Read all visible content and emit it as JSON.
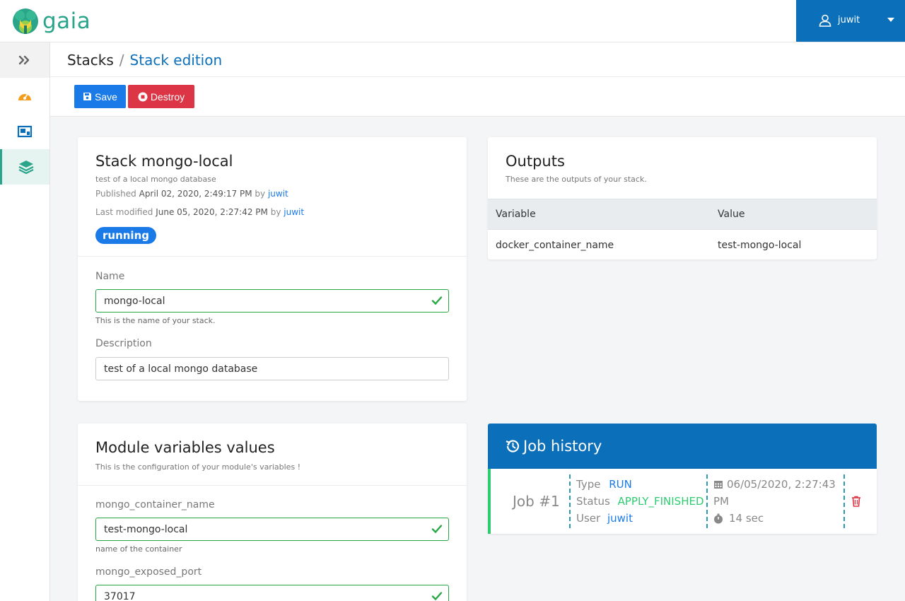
{
  "app": {
    "logo_text": "gaia"
  },
  "user": {
    "name": "juwit"
  },
  "breadcrumb": {
    "root": "Stacks",
    "separator": "/",
    "current": "Stack edition"
  },
  "toolbar": {
    "save_label": "Save",
    "destroy_label": "Destroy"
  },
  "sidebar": {
    "items": [
      {
        "icon": "dashboard-icon"
      },
      {
        "icon": "modules-icon"
      },
      {
        "icon": "stacks-icon",
        "active": true
      }
    ]
  },
  "stack_card": {
    "title": "Stack mongo-local",
    "description": "test of a local mongo database",
    "published_prefix": "Published",
    "published_date": "April 02, 2020, 2:49:17 PM",
    "published_by": "by",
    "published_user": "juwit",
    "modified_prefix": "Last modified",
    "modified_date": "June 05, 2020, 2:27:42 PM",
    "modified_by": "by",
    "modified_user": "juwit",
    "status": "running",
    "name_label": "Name",
    "name_value": "mongo-local",
    "name_help": "This is the name of your stack.",
    "description_label": "Description",
    "description_value": "test of a local mongo database"
  },
  "outputs_card": {
    "title": "Outputs",
    "subtitle": "These are the outputs of your stack.",
    "columns": [
      "Variable",
      "Value"
    ],
    "rows": [
      {
        "variable": "docker_container_name",
        "value": "test-mongo-local"
      }
    ]
  },
  "variables_card": {
    "title": "Module variables values",
    "subtitle": "This is the configuration of your module's variables !",
    "vars": [
      {
        "label": "mongo_container_name",
        "value": "test-mongo-local",
        "help": "name of the container"
      },
      {
        "label": "mongo_exposed_port",
        "value": "37017"
      }
    ]
  },
  "job_history": {
    "title": "Job history",
    "jobs": [
      {
        "number": "Job #1",
        "type_label": "Type",
        "type_value": "RUN",
        "status_label": "Status",
        "status_value": "APPLY_FINISHED",
        "user_label": "User",
        "user_value": "juwit",
        "date": "06/05/2020, 2:27:43",
        "date_suffix": "PM",
        "duration": "14 sec"
      }
    ]
  },
  "colors": {
    "primary": "#0b6fba",
    "accent": "#2aa58a",
    "danger": "#dc3545",
    "success": "#2ecc71",
    "link": "#1a7ae8"
  }
}
